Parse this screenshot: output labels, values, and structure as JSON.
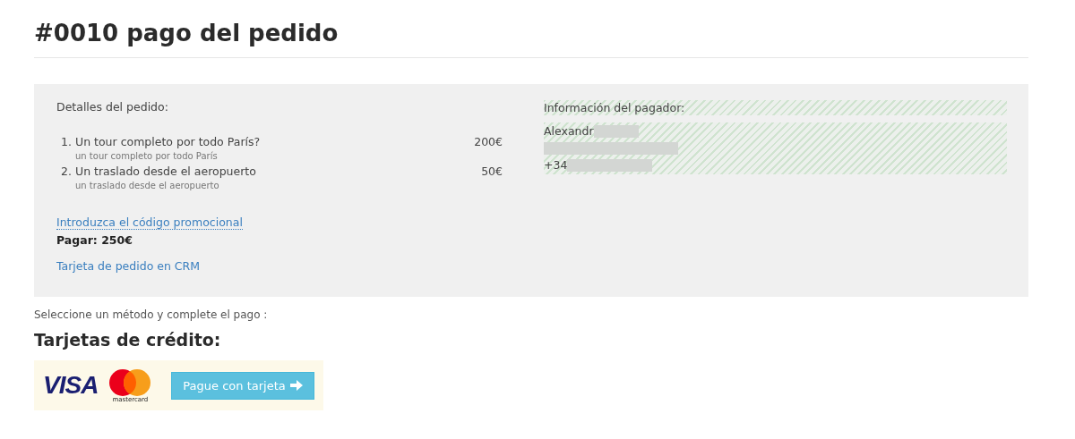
{
  "title": "#0010 pago del pedido",
  "order": {
    "heading": "Detalles del pedido:",
    "items": [
      {
        "number": "1.",
        "name": "Un tour completo por todo París?",
        "price": "200€",
        "description": "un tour completo por todo París"
      },
      {
        "number": "2.",
        "name": "Un traslado desde el aeropuerto",
        "price": "50€",
        "description": "un traslado desde el aeropuerto"
      }
    ],
    "promo_link": "Introduzca el código promocional",
    "total": "Pagar: 250€",
    "crm_link": "Tarjeta de pedido en CRM"
  },
  "payer": {
    "heading": "Información del pagador:",
    "name": "Alexandr",
    "phone": "+34"
  },
  "instruction": "Seleccione un método y complete el pago :",
  "payment": {
    "heading": "Tarjetas de crédito:",
    "visa_logo": "VISA",
    "mastercard_logo": "mastercard",
    "button": "Pague con tarjeta"
  }
}
